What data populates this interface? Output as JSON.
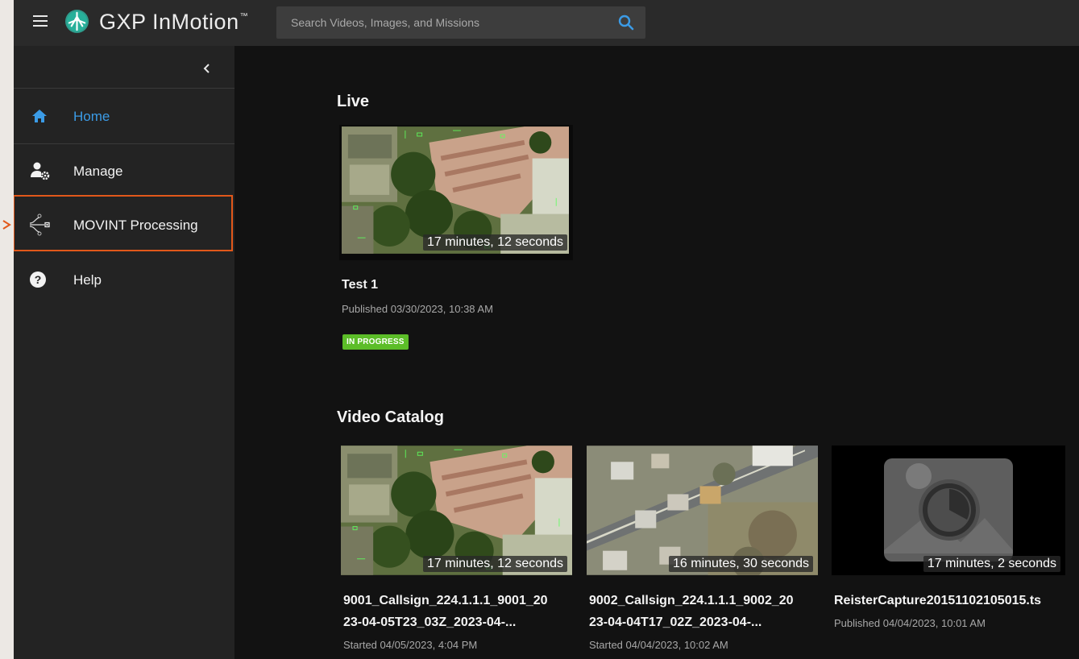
{
  "app": {
    "name": "GXP InMotion",
    "trademark": "™",
    "accent_color": "#3b9be6",
    "badge_color": "#5cbd28",
    "highlight_color": "#e2581a"
  },
  "search": {
    "placeholder": "Search Videos, Images, and Missions",
    "icon": "search-icon"
  },
  "sidebar": {
    "items": [
      {
        "label": "Home",
        "icon": "home-icon",
        "active": true
      },
      {
        "label": "Manage",
        "icon": "user-settings-icon",
        "active": false
      },
      {
        "label": "MOVINT Processing",
        "icon": "movint-processing-icon",
        "active": false,
        "highlighted": true
      },
      {
        "label": "Help",
        "icon": "help-icon",
        "active": false
      }
    ]
  },
  "live": {
    "title": "Live",
    "cards": [
      {
        "thumbnail": "aerial-buildings-green-overlay",
        "duration": "17 minutes, 12 seconds",
        "title": "Test 1",
        "meta": "Published 03/30/2023, 10:38 AM",
        "badge": "IN PROGRESS"
      }
    ]
  },
  "catalog": {
    "title": "Video Catalog",
    "cards": [
      {
        "thumbnail": "aerial-buildings-green-overlay",
        "duration": "17 minutes, 12 seconds",
        "title_line1": "9001_Callsign_224.1.1.1_9001_20",
        "title_line2": "23-04-05T23_03Z_2023-04-...",
        "meta": "Started 04/05/2023, 4:04 PM"
      },
      {
        "thumbnail": "aerial-street-neighborhood",
        "duration": "16 minutes, 30 seconds",
        "title_line1": "9002_Callsign_224.1.1.1_9002_20",
        "title_line2": "23-04-04T17_02Z_2023-04-...",
        "meta": "Started 04/04/2023, 10:02 AM"
      },
      {
        "thumbnail": "video-placeholder-icon",
        "duration": "17 minutes, 2 seconds",
        "title_line1": "ReisterCapture20151102105015.ts",
        "meta": "Published 04/04/2023, 10:01 AM"
      }
    ]
  }
}
